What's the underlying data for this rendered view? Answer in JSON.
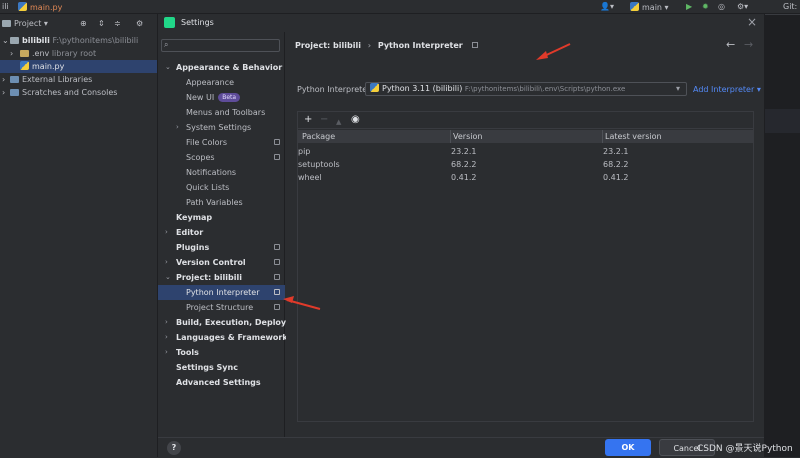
{
  "ide": {
    "top_left_project": "ili",
    "top_left_file": "main.py",
    "project_tool": "Project",
    "run_config": "main",
    "git_label": "Git:"
  },
  "project_tree": {
    "root_name": "bilibili",
    "root_path": "F:\\pythonitems\\bilibili",
    "env_name": ".env",
    "env_note": "library root",
    "main_file": "main.py",
    "external": "External Libraries",
    "scratches": "Scratches and Consoles"
  },
  "dialog": {
    "title": "Settings",
    "close": "×",
    "search_placeholder": "",
    "help": "?",
    "ok": "OK",
    "cancel": "Cancel"
  },
  "nav": {
    "appearance_behavior": "Appearance & Behavior",
    "appearance": "Appearance",
    "new_ui": "New UI",
    "beta": "Beta",
    "menus_toolbars": "Menus and Toolbars",
    "system_settings": "System Settings",
    "file_colors": "File Colors",
    "scopes": "Scopes",
    "notifications": "Notifications",
    "quick_lists": "Quick Lists",
    "path_variables": "Path Variables",
    "keymap": "Keymap",
    "editor": "Editor",
    "plugins": "Plugins",
    "version_control": "Version Control",
    "project": "Project: bilibili",
    "python_interpreter": "Python Interpreter",
    "project_structure": "Project Structure",
    "build": "Build, Execution, Deployment",
    "languages": "Languages & Frameworks",
    "tools": "Tools",
    "settings_sync": "Settings Sync",
    "advanced": "Advanced Settings"
  },
  "main": {
    "crumb_project": "Project: bilibili",
    "crumb_sep": "›",
    "crumb_page": "Python Interpreter",
    "interp_label": "Python Interpreter:",
    "interp_name": "Python 3.11 (bilibili)",
    "interp_path": "F:\\pythonitems\\bilibili\\.env\\Scripts\\python.exe",
    "add_interpreter": "Add Interpreter",
    "columns": [
      "Package",
      "Version",
      "Latest version"
    ],
    "packages": [
      {
        "name": "pip",
        "version": "23.2.1",
        "latest": "23.2.1"
      },
      {
        "name": "setuptools",
        "version": "68.2.2",
        "latest": "68.2.2"
      },
      {
        "name": "wheel",
        "version": "0.41.2",
        "latest": "0.41.2"
      }
    ]
  },
  "watermark": "CSDN @景天说Python",
  "colors": {
    "accent": "#3574f0",
    "selection": "#2e436e",
    "link": "#548af7",
    "arrow": "#e03a2a"
  }
}
